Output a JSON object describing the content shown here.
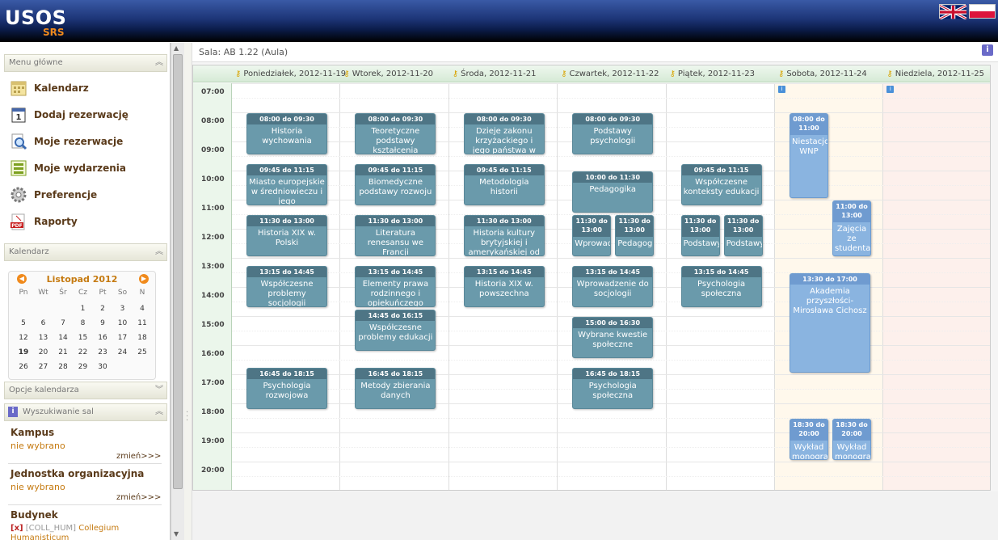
{
  "app": {
    "logo": "USOS",
    "logo_sub": "SRS"
  },
  "flags": {
    "en": "en-flag",
    "pl": "pl-flag"
  },
  "left": {
    "menu_title": "Menu główne",
    "menu": [
      {
        "label": "Kalendarz",
        "icon": "calendar-icon"
      },
      {
        "label": "Dodaj rezerwację",
        "icon": "calendar-add-icon"
      },
      {
        "label": "Moje rezerwacje",
        "icon": "search-icon"
      },
      {
        "label": "Moje wydarzenia",
        "icon": "list-icon"
      },
      {
        "label": "Preferencje",
        "icon": "gear-icon"
      },
      {
        "label": "Raporty",
        "icon": "pdf-icon"
      }
    ],
    "calendar_title": "Kalendarz",
    "calendar": {
      "month": "Listopad 2012",
      "days": [
        "Pn",
        "Wt",
        "Śr",
        "Cz",
        "Pt",
        "So",
        "N"
      ],
      "weeks": [
        [
          "",
          "",
          "",
          "1",
          "2",
          "3",
          "4"
        ],
        [
          "5",
          "6",
          "7",
          "8",
          "9",
          "10",
          "11"
        ],
        [
          "12",
          "13",
          "14",
          "15",
          "16",
          "17",
          "18"
        ],
        [
          "19",
          "20",
          "21",
          "22",
          "23",
          "24",
          "25"
        ],
        [
          "26",
          "27",
          "28",
          "29",
          "30",
          "",
          ""
        ]
      ],
      "today": "19"
    },
    "options_title": "Opcje kalendarza",
    "search_title": "Wyszukiwanie sal",
    "search": [
      {
        "title": "Kampus",
        "value": "nie wybrano",
        "link": "zmień>>>"
      },
      {
        "title": "Jednostka organizacyjna",
        "value": "nie wybrano",
        "link": "zmień>>>"
      }
    ],
    "building_title": "Budynek",
    "building_remove": "[x]",
    "building_code": "[COLL_HUM]",
    "building_name_1": "Collegium",
    "building_name_2": "Humanisticum"
  },
  "main": {
    "room": "Sala: AB 1.22 (Aula)",
    "info": "i",
    "days": [
      "Poniedziałek, 2012-11-19",
      "Wtorek, 2012-11-20",
      "Środa, 2012-11-21",
      "Czwartek, 2012-11-22",
      "Piątek, 2012-11-23",
      "Sobota, 2012-11-24",
      "Niedziela, 2012-11-25"
    ],
    "hours": [
      "07:00",
      "08:00",
      "09:00",
      "10:00",
      "11:00",
      "12:00",
      "13:00",
      "14:00",
      "15:00",
      "16:00",
      "17:00",
      "18:00",
      "19:00",
      "20:00"
    ],
    "events": [
      {
        "day": 0,
        "start": "08:00",
        "end": "09:30",
        "time": "08:00 do 09:30",
        "name": "Historia wychowania"
      },
      {
        "day": 0,
        "start": "09:45",
        "end": "11:15",
        "time": "09:45 do 11:15",
        "name": "Miasto europejskie w średniowieczu i jego"
      },
      {
        "day": 0,
        "start": "11:30",
        "end": "13:00",
        "time": "11:30 do 13:00",
        "name": "Historia XIX w. Polski"
      },
      {
        "day": 0,
        "start": "13:15",
        "end": "14:45",
        "time": "13:15 do 14:45",
        "name": "Współczesne problemy socjologii"
      },
      {
        "day": 0,
        "start": "16:45",
        "end": "18:15",
        "time": "16:45 do 18:15",
        "name": "Psychologia rozwojowa"
      },
      {
        "day": 1,
        "start": "08:00",
        "end": "09:30",
        "time": "08:00 do 09:30",
        "name": "Teoretyczne podstawy kształcenia"
      },
      {
        "day": 1,
        "start": "09:45",
        "end": "11:15",
        "time": "09:45 do 11:15",
        "name": "Biomedyczne podstawy rozwoju"
      },
      {
        "day": 1,
        "start": "11:30",
        "end": "13:00",
        "time": "11:30 do 13:00",
        "name": "Literatura renesansu we Francji"
      },
      {
        "day": 1,
        "start": "13:15",
        "end": "14:45",
        "time": "13:15 do 14:45",
        "name": "Elementy prawa rodzinnego i opiekuńczego"
      },
      {
        "day": 1,
        "start": "14:45",
        "end": "16:15",
        "time": "14:45 do 16:15",
        "name": "Współczesne problemy edukacji"
      },
      {
        "day": 1,
        "start": "16:45",
        "end": "18:15",
        "time": "16:45 do 18:15",
        "name": "Metody zbierania danych"
      },
      {
        "day": 2,
        "start": "08:00",
        "end": "09:30",
        "time": "08:00 do 09:30",
        "name": "Dzieje zakonu krzyżackiego i jego państwa w"
      },
      {
        "day": 2,
        "start": "09:45",
        "end": "11:15",
        "time": "09:45 do 11:15",
        "name": "Metodologia historii"
      },
      {
        "day": 2,
        "start": "11:30",
        "end": "13:00",
        "time": "11:30 do 13:00",
        "name": "Historia kultury brytyjskiej i amerykańskiej od"
      },
      {
        "day": 2,
        "start": "13:15",
        "end": "14:45",
        "time": "13:15 do 14:45",
        "name": "Historia XIX w. powszechna"
      },
      {
        "day": 3,
        "start": "08:00",
        "end": "09:30",
        "time": "08:00 do 09:30",
        "name": "Podstawy psychologii"
      },
      {
        "day": 3,
        "start": "10:00",
        "end": "11:30",
        "time": "10:00 do 11:30",
        "name": "Pedagogika"
      },
      {
        "day": 3,
        "start": "11:30",
        "end": "13:00",
        "time": "11:30 do 13:00",
        "name": "Wprowadzeni",
        "slot": 0
      },
      {
        "day": 3,
        "start": "11:30",
        "end": "13:00",
        "time": "11:30 do 13:00",
        "name": "Pedagogika",
        "slot": 1
      },
      {
        "day": 3,
        "start": "13:15",
        "end": "14:45",
        "time": "13:15 do 14:45",
        "name": "Wprowadzenie do socjologii"
      },
      {
        "day": 3,
        "start": "15:00",
        "end": "16:30",
        "time": "15:00 do 16:30",
        "name": "Wybrane kwestie społeczne"
      },
      {
        "day": 3,
        "start": "16:45",
        "end": "18:15",
        "time": "16:45 do 18:15",
        "name": "Psychologia społeczna"
      },
      {
        "day": 4,
        "start": "09:45",
        "end": "11:15",
        "time": "09:45 do 11:15",
        "name": "Współczesne konteksty edukacji"
      },
      {
        "day": 4,
        "start": "11:30",
        "end": "13:00",
        "time": "11:30 do 13:00",
        "name": "Podstawy",
        "slot": 0
      },
      {
        "day": 4,
        "start": "11:30",
        "end": "13:00",
        "time": "11:30 do 13:00",
        "name": "Podstawy",
        "slot": 1
      },
      {
        "day": 4,
        "start": "13:15",
        "end": "14:45",
        "time": "13:15 do 14:45",
        "name": "Psychologia społeczna"
      },
      {
        "day": 5,
        "start": "08:00",
        "end": "11:00",
        "time": "08:00 do 11:00",
        "name": "Niestacjonarni WNP",
        "blue": true,
        "slot": 0
      },
      {
        "day": 5,
        "start": "11:00",
        "end": "13:00",
        "time": "11:00 do 13:00",
        "name": "Zajęcia ze studentami",
        "blue": true,
        "slot": 1
      },
      {
        "day": 5,
        "start": "13:30",
        "end": "17:00",
        "time": "13:30 do 17:00",
        "name": "Akademia przyszłości- Mirosława Cichosz",
        "blue": true,
        "wide": true
      },
      {
        "day": 5,
        "start": "18:30",
        "end": "20:00",
        "time": "18:30 do 20:00",
        "name": "Wykład monograficzny",
        "blue": true,
        "slot": 0
      },
      {
        "day": 5,
        "start": "18:30",
        "end": "20:00",
        "time": "18:30 do 20:00",
        "name": "Wykład monograficzny",
        "blue": true,
        "slot": 1
      }
    ]
  }
}
